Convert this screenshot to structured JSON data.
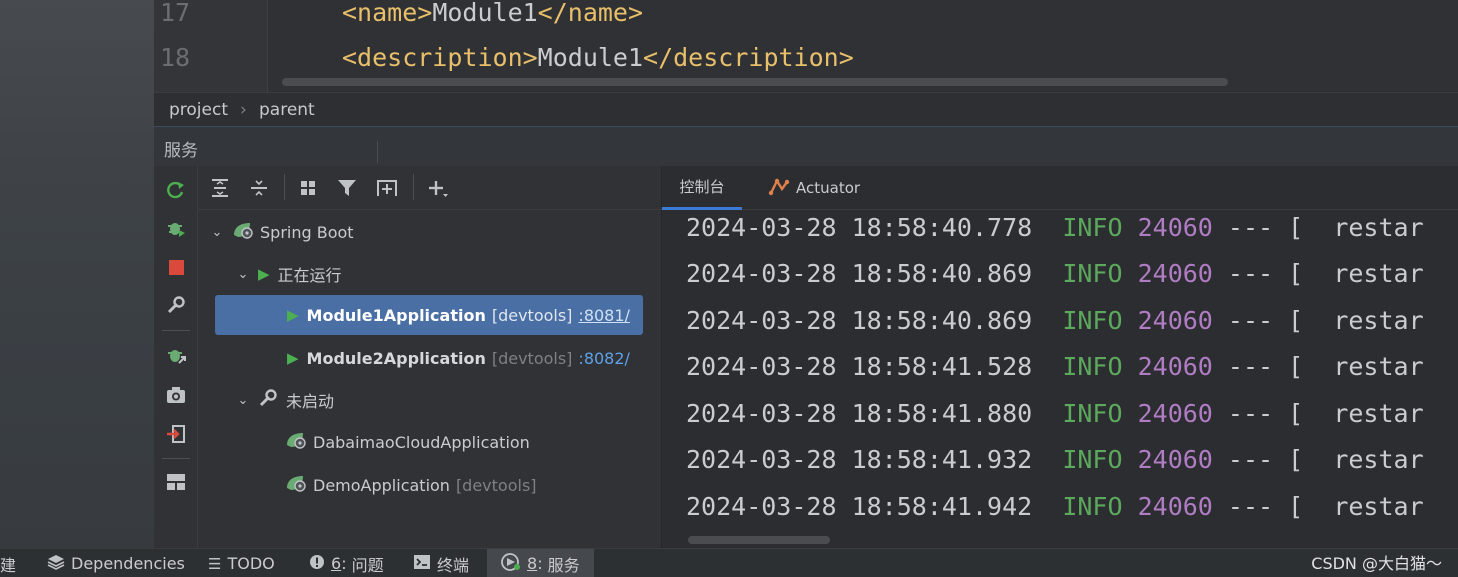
{
  "editor": {
    "lines": [
      {
        "number": "17",
        "open_tag": "<name>",
        "text": "Module1",
        "close_tag": "</name>"
      },
      {
        "number": "18",
        "open_tag": "<description>",
        "text": "Module1",
        "close_tag": "</description>"
      }
    ]
  },
  "breadcrumb": {
    "items": [
      "project",
      "parent"
    ],
    "separator": "›"
  },
  "services": {
    "title": "服务"
  },
  "tree": {
    "spring_boot": "Spring Boot",
    "running_group": "正在运行",
    "stopped_group": "未启动",
    "apps": [
      {
        "name": "Module1Application",
        "tag": "[devtools]",
        "port": ":8081/"
      },
      {
        "name": "Module2Application",
        "tag": "[devtools]",
        "port": ":8082/"
      },
      {
        "name": "DabaimaoCloudApplication",
        "tag": "",
        "port": ""
      },
      {
        "name": "DemoApplication",
        "tag": "[devtools]",
        "port": ""
      }
    ]
  },
  "console": {
    "tabs": [
      "控制台",
      "Actuator"
    ],
    "logs": [
      {
        "date": "2024-03-28",
        "time": "18:58:40.778",
        "level": "INFO",
        "pid": "24060",
        "sep": "---",
        "bracket": "[",
        "thread": "restar"
      },
      {
        "date": "2024-03-28",
        "time": "18:58:40.869",
        "level": "INFO",
        "pid": "24060",
        "sep": "---",
        "bracket": "[",
        "thread": "restar"
      },
      {
        "date": "2024-03-28",
        "time": "18:58:40.869",
        "level": "INFO",
        "pid": "24060",
        "sep": "---",
        "bracket": "[",
        "thread": "restar"
      },
      {
        "date": "2024-03-28",
        "time": "18:58:41.528",
        "level": "INFO",
        "pid": "24060",
        "sep": "---",
        "bracket": "[",
        "thread": "restar"
      },
      {
        "date": "2024-03-28",
        "time": "18:58:41.880",
        "level": "INFO",
        "pid": "24060",
        "sep": "---",
        "bracket": "[",
        "thread": "restar"
      },
      {
        "date": "2024-03-28",
        "time": "18:58:41.932",
        "level": "INFO",
        "pid": "24060",
        "sep": "---",
        "bracket": "[",
        "thread": "restar"
      },
      {
        "date": "2024-03-28",
        "time": "18:58:41.942",
        "level": "INFO",
        "pid": "24060",
        "sep": "---",
        "bracket": "[",
        "thread": "restar"
      }
    ]
  },
  "bottom_bar": {
    "items": [
      {
        "key": "",
        "label": "建"
      },
      {
        "key": "",
        "label": "Dependencies"
      },
      {
        "key": "",
        "label": "TODO"
      },
      {
        "key": "6",
        "label": "问题"
      },
      {
        "key": "",
        "label": "终端"
      },
      {
        "key": "8",
        "label": "服务"
      }
    ],
    "key_suffix": ":",
    "watermark": "CSDN @大白猫～"
  },
  "colors": {
    "accent": "#4a6fa5",
    "info": "#5ca85c",
    "pid": "#b07cc4",
    "xml_tag": "#e8bf6a"
  }
}
